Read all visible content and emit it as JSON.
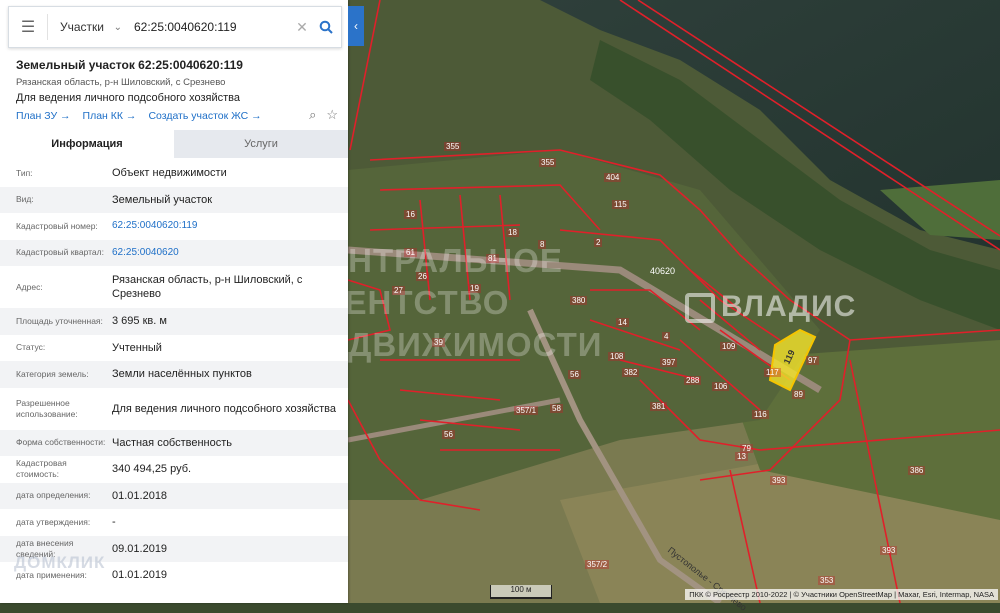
{
  "search": {
    "layer": "Участки",
    "query": "62:25:0040620:119"
  },
  "card": {
    "title": "Земельный участок 62:25:0040620:119",
    "subtitle": "Рязанская область, р-н Шиловский, с Срезнево",
    "purpose": "Для ведения личного подсобного хозяйства",
    "links": [
      "План ЗУ →",
      "План КК →",
      "Создать участок ЖС →"
    ]
  },
  "tabs": {
    "info": "Информация",
    "services": "Услуги"
  },
  "details": [
    {
      "label": "Тип:",
      "value": "Объект недвижимости"
    },
    {
      "label": "Вид:",
      "value": "Земельный участок"
    },
    {
      "label": "Кадастровый номер:",
      "value": "62:25:0040620:119"
    },
    {
      "label": "Кадастровый квартал:",
      "value": "62:25:0040620"
    },
    {
      "label": "Адрес:",
      "value": "Рязанская область, р-н Шиловский, с Срезнево"
    },
    {
      "label": "Площадь уточненная:",
      "value": "3 695 кв. м"
    },
    {
      "label": "Статус:",
      "value": "Учтенный"
    },
    {
      "label": "Категория земель:",
      "value": "Земли населённых пунктов"
    },
    {
      "label": "Разрешенное использование:",
      "value": "Для ведения личного подсобного хозяйства"
    },
    {
      "label": "Форма собственности:",
      "value": "Частная собственность"
    },
    {
      "label": "Кадастровая стоимость:",
      "value": "340 494,25 руб."
    },
    {
      "label": "дата определения:",
      "value": "01.01.2018"
    },
    {
      "label": "дата утверждения:",
      "value": "-"
    },
    {
      "label": "дата внесения сведений:",
      "value": "09.01.2019"
    },
    {
      "label": "дата применения:",
      "value": "01.01.2019"
    }
  ],
  "watermark_panel": "ДОМКЛИК",
  "map": {
    "watermark_lines": [
      "ЦЕНТРАЛЬНОЕ",
      "АГЕНТСТВО",
      "НЕДВИЖИМОСТИ"
    ],
    "brand": "ВЛАДИС",
    "quarter": "40620",
    "parcel_selected": "119",
    "parcel_labels": [
      "355",
      "355",
      "404",
      "115",
      "16",
      "18",
      "2",
      "8",
      "19",
      "380",
      "14",
      "108",
      "382",
      "397",
      "288",
      "106",
      "109",
      "116",
      "97",
      "89",
      "117",
      "13",
      "381",
      "386",
      "393",
      "393",
      "353",
      "357/2",
      "357/1",
      "58",
      "56",
      "81",
      "56",
      "39",
      "61",
      "27",
      "26",
      "4",
      "79"
    ],
    "road_label": "Пустополье - Срезнево",
    "scale": "100 м",
    "attribution": "ПКК © Росреестр 2010-2022 | © Участники OpenStreetMap | Maxar, Esri, Intermap, NASA"
  },
  "colors": {
    "accent": "#2b73c9",
    "parcel_border": "#e0202a",
    "selected_fill": "#f5e42a"
  }
}
